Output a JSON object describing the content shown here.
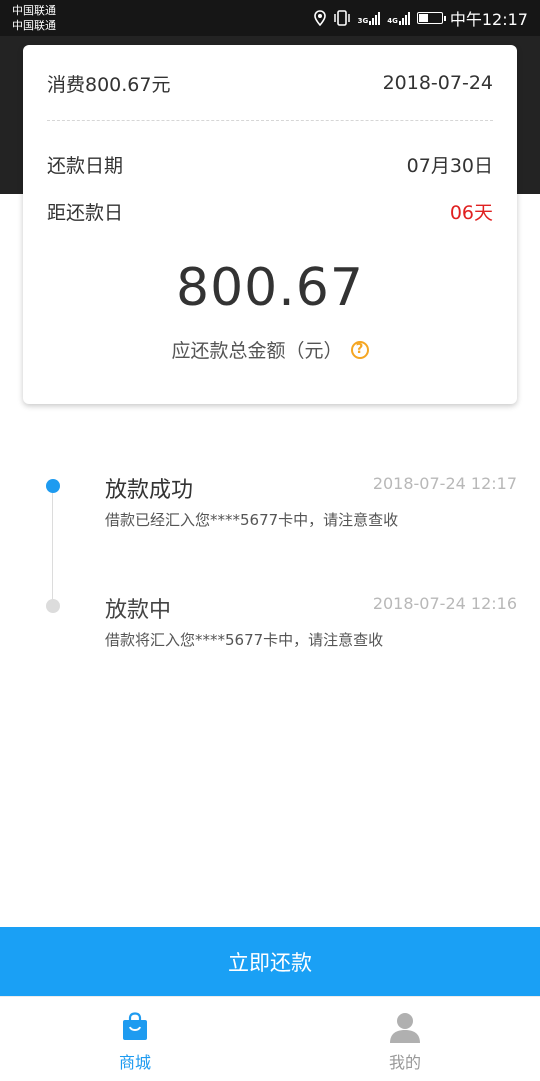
{
  "status_bar": {
    "carrier1": "中国联通",
    "carrier2": "中国联通",
    "network1": "3G",
    "network2": "4G",
    "time": "中午12:17"
  },
  "card": {
    "consume_label": "消费800.67元",
    "date": "2018-07-24",
    "repay_date_label": "还款日期",
    "repay_date_value": "07月30日",
    "days_left_label": "距还款日",
    "days_left_value": "06天",
    "total_amount": "800.67",
    "total_amount_label": "应还款总金额（元）",
    "help_icon": "question-circle-icon",
    "help_glyph": "?"
  },
  "timeline": [
    {
      "title": "放款成功",
      "time": "2018-07-24 12:17",
      "desc": "借款已经汇入您****5677卡中，请注意查收",
      "state": "active"
    },
    {
      "title": "放款中",
      "time": "2018-07-24 12:16",
      "desc": "借款将汇入您****5677卡中，请注意查收",
      "state": "inactive"
    }
  ],
  "repay_button": {
    "label": "立即还款"
  },
  "bottom_nav": {
    "items": [
      {
        "label": "商城",
        "icon": "shopping-bag-icon",
        "active": true
      },
      {
        "label": "我的",
        "icon": "user-icon",
        "active": false
      }
    ]
  },
  "colors": {
    "accent": "#1aa0f5",
    "header_bg": "#232323",
    "warning": "#e02020",
    "help": "#f5a623"
  }
}
